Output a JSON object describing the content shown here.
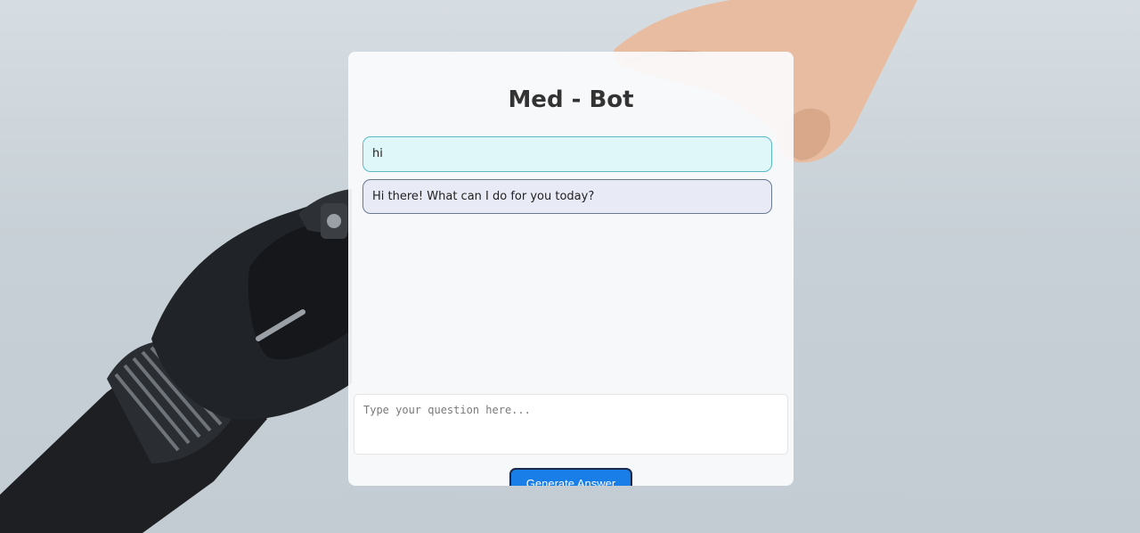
{
  "app": {
    "title": "Med - Bot"
  },
  "chat": {
    "messages": [
      {
        "role": "user",
        "text": "hi"
      },
      {
        "role": "bot",
        "text": "Hi there! What can I do for you today?"
      }
    ]
  },
  "input": {
    "placeholder": "Type your question here...",
    "value": ""
  },
  "actions": {
    "generate_label": "Generate Answer"
  },
  "background": {
    "image": "robot-hand-reaching-human-hand",
    "colors": {
      "backdrop": "#c7d0d6",
      "robot": "#1c1e21",
      "skin": "#e9bfa4"
    }
  },
  "colors": {
    "user_bubble_bg": "#e0f7fa",
    "user_bubble_border": "#5ab8c6",
    "bot_bubble_bg": "#e8eaf6",
    "bot_bubble_border": "#6b7a90",
    "button_bg": "#1a7ee8",
    "title_text": "#333333"
  }
}
